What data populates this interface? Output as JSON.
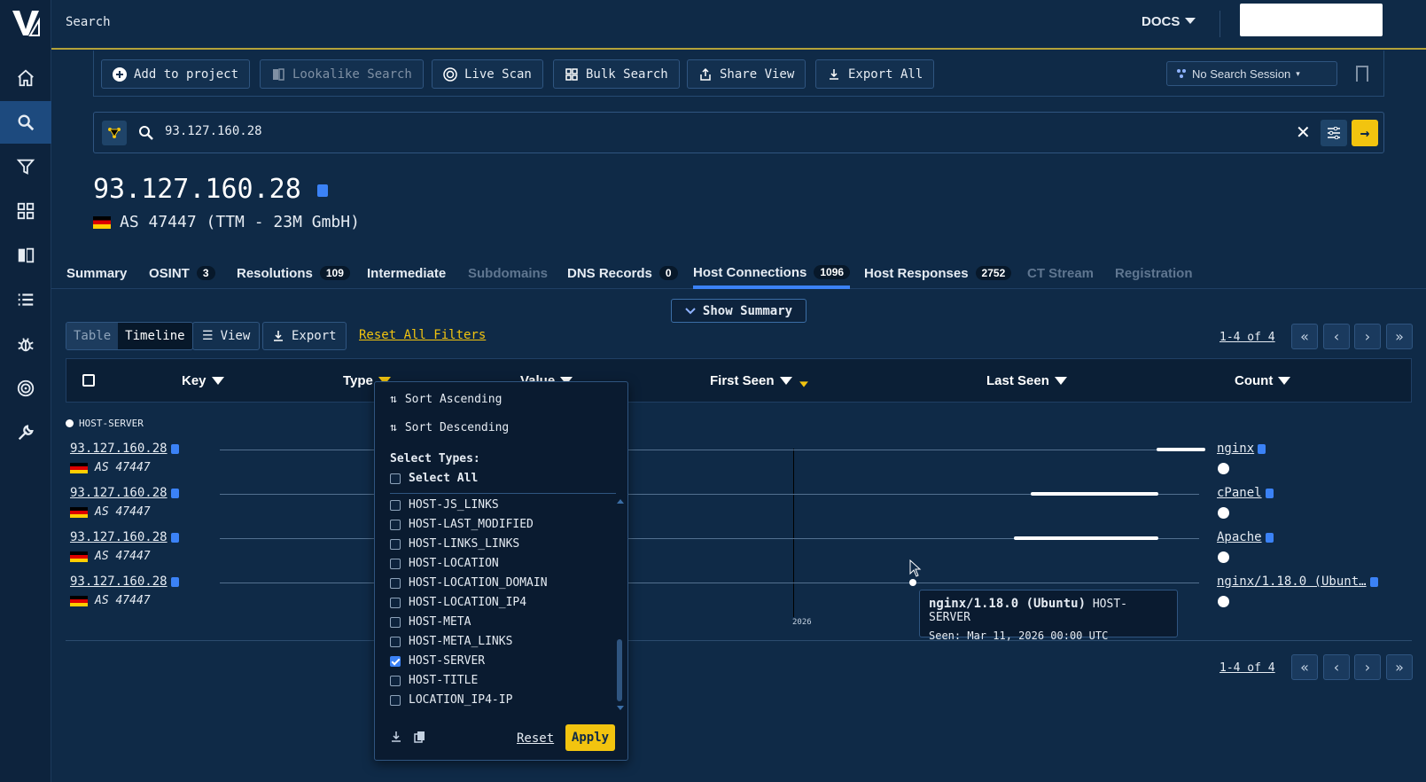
{
  "app": {
    "title": "Search"
  },
  "header": {
    "docs_label": "DOCS"
  },
  "toolbar": {
    "add_to_project": "Add to project",
    "lookalike": "Lookalike Search",
    "live_scan": "Live Scan",
    "bulk_search": "Bulk Search",
    "share_view": "Share View",
    "export_all": "Export All",
    "session": "No Search Session"
  },
  "search": {
    "value": "93.127.160.28"
  },
  "entity": {
    "ip": "93.127.160.28",
    "asn": "AS 47447 (TTM - 23M GmbH)"
  },
  "tabs": [
    {
      "label": "Summary",
      "badge": ""
    },
    {
      "label": "OSINT",
      "badge": "3"
    },
    {
      "label": "Resolutions",
      "badge": "109"
    },
    {
      "label": "Intermediate",
      "badge": ""
    },
    {
      "label": "Subdomains",
      "badge": ""
    },
    {
      "label": "DNS Records",
      "badge": "0"
    },
    {
      "label": "Host Connections",
      "badge": "1096"
    },
    {
      "label": "Host Responses",
      "badge": "2752"
    },
    {
      "label": "CT Stream",
      "badge": ""
    },
    {
      "label": "Registration",
      "badge": ""
    }
  ],
  "show_summary": "Show Summary",
  "view": {
    "table": "Table",
    "timeline": "Timeline",
    "view_btn": "View",
    "export_btn": "Export",
    "reset_filters": "Reset All Filters",
    "pager": "1-4 of 4"
  },
  "columns": {
    "key": "Key",
    "type": "Type",
    "value": "Value",
    "first_seen": "First Seen",
    "last_seen": "Last Seen",
    "count": "Count"
  },
  "group": "HOST-SERVER",
  "rows": [
    {
      "ip": "93.127.160.28",
      "as": "AS 47447",
      "value": "nginx"
    },
    {
      "ip": "93.127.160.28",
      "as": "AS 47447",
      "value": "cPanel"
    },
    {
      "ip": "93.127.160.28",
      "as": "AS 47447",
      "value": "Apache"
    },
    {
      "ip": "93.127.160.28",
      "as": "AS 47447",
      "value": "nginx/1.18.0 (Ubunt…"
    }
  ],
  "year_label": "2026",
  "tooltip": {
    "name": "nginx/1.18.0 (Ubuntu)",
    "type": "HOST-SERVER",
    "seen": "Seen: Mar 11, 2026 00:00 UTC"
  },
  "dropdown": {
    "sort_asc": "Sort Ascending",
    "sort_desc": "Sort Descending",
    "select_types": "Select Types:",
    "select_all": "Select All",
    "options": [
      {
        "label": "HOST-JS_LINKS",
        "checked": false
      },
      {
        "label": "HOST-LAST_MODIFIED",
        "checked": false
      },
      {
        "label": "HOST-LINKS_LINKS",
        "checked": false
      },
      {
        "label": "HOST-LOCATION",
        "checked": false
      },
      {
        "label": "HOST-LOCATION_DOMAIN",
        "checked": false
      },
      {
        "label": "HOST-LOCATION_IP4",
        "checked": false
      },
      {
        "label": "HOST-META",
        "checked": false
      },
      {
        "label": "HOST-META_LINKS",
        "checked": false
      },
      {
        "label": "HOST-SERVER",
        "checked": true
      },
      {
        "label": "HOST-TITLE",
        "checked": false
      },
      {
        "label": "LOCATION_IP4-IP",
        "checked": false
      }
    ],
    "reset": "Reset",
    "apply": "Apply"
  }
}
